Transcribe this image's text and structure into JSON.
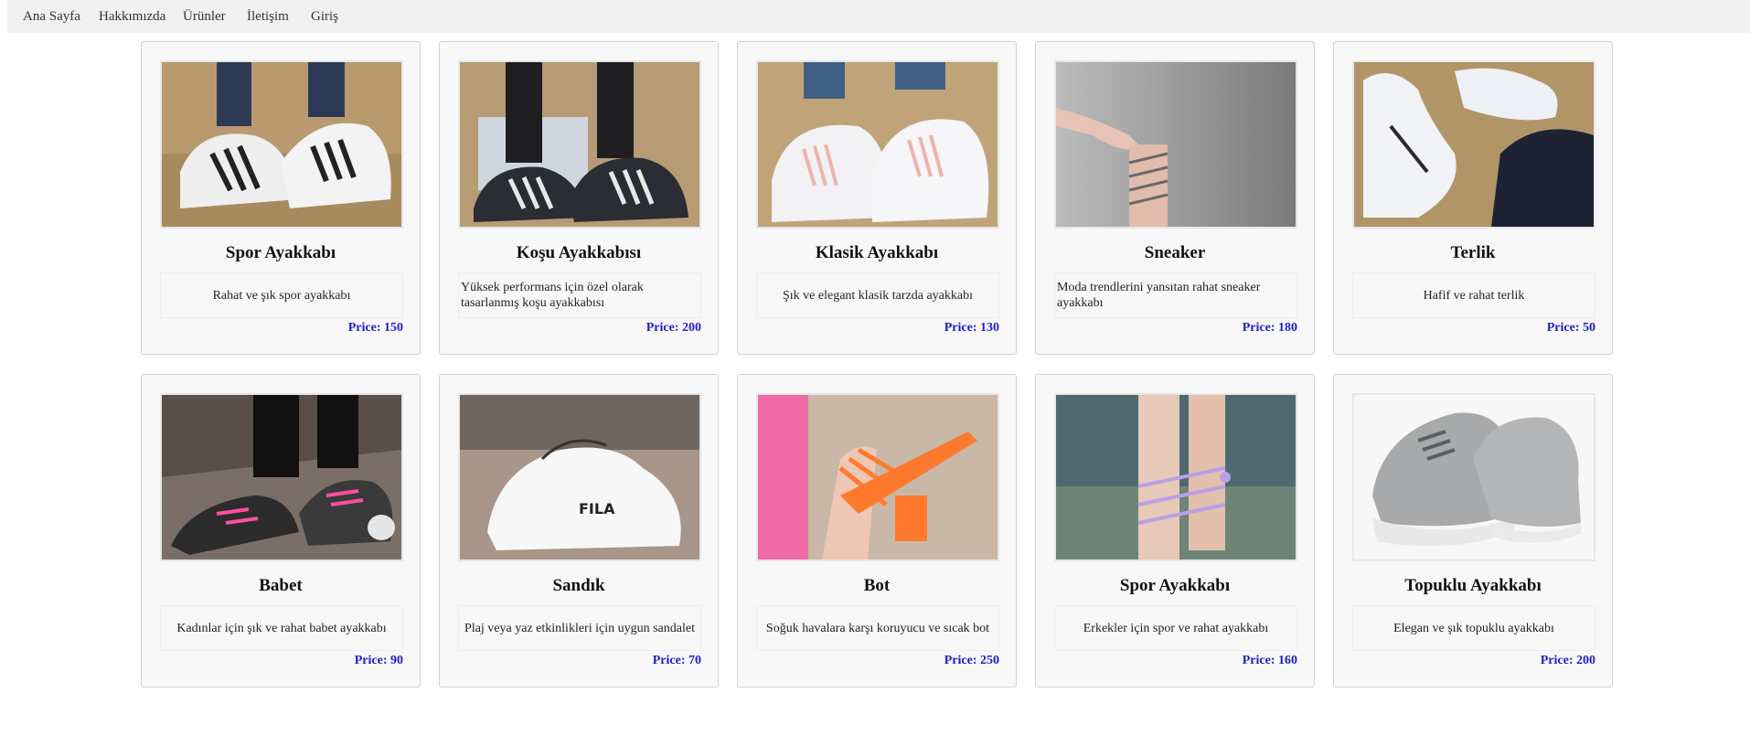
{
  "nav": [
    {
      "label": "Ana Sayfa"
    },
    {
      "label": "Hakkımızda"
    },
    {
      "label": "Ürünler"
    },
    {
      "label": "İletişim"
    },
    {
      "label": "Giriş"
    }
  ],
  "products": [
    {
      "title": "Spor Ayakkabı",
      "desc": "Rahat ve şık spor ayakkabı",
      "price": "Price: 150",
      "image": "white sneakers with black stripes on fur rug"
    },
    {
      "title": "Koşu Ayakkabısı",
      "desc": "Yüksek performans için özel olarak tasarlanmış koşu ayakkabısı",
      "price": "Price: 200",
      "image": "black sneakers with white stripes on fur rug"
    },
    {
      "title": "Klasik Ayakkabı",
      "desc": "Şık ve elegant klasik tarzda ayakkabı",
      "price": "Price: 130",
      "image": "white sneakers with pink stripes"
    },
    {
      "title": "Sneaker",
      "desc": "Moda trendlerini yansıtan rahat sneaker ayakkabı",
      "price": "Price: 180",
      "image": "ankle with wrapped strap on grey background"
    },
    {
      "title": "Terlik",
      "desc": "Hafif ve rahat terlik",
      "price": "Price: 50",
      "image": "white chunky sneakers on fur rug"
    },
    {
      "title": "Babet",
      "desc": "Kadınlar için şık ve rahat babet ayakkabı",
      "price": "Price: 90",
      "image": "black and pink sneakers on wooden deck"
    },
    {
      "title": "Sandık",
      "desc": "Plaj veya yaz etkinlikleri için uygun sandalet",
      "price": "Price: 70",
      "image": "white FILA sneakers"
    },
    {
      "title": "Bot",
      "desc": "Soğuk havalara karşı koruyucu ve sıcak bot",
      "price": "Price: 250",
      "image": "orange strappy heeled sandals"
    },
    {
      "title": "Spor Ayakkabı",
      "desc": "Erkekler için spor ve rahat ayakkabı",
      "price": "Price: 160",
      "image": "lilac lace-up sandals"
    },
    {
      "title": "Topuklu Ayakkabı",
      "desc": "Elegan ve şık topuklu ayakkabı",
      "price": "Price: 200",
      "image": "grey chunky sneakers on white"
    }
  ],
  "colors": {
    "nav_bg": "#f1f1f1",
    "card_bg": "#f8f8f8",
    "price": "#1c1ccc"
  }
}
